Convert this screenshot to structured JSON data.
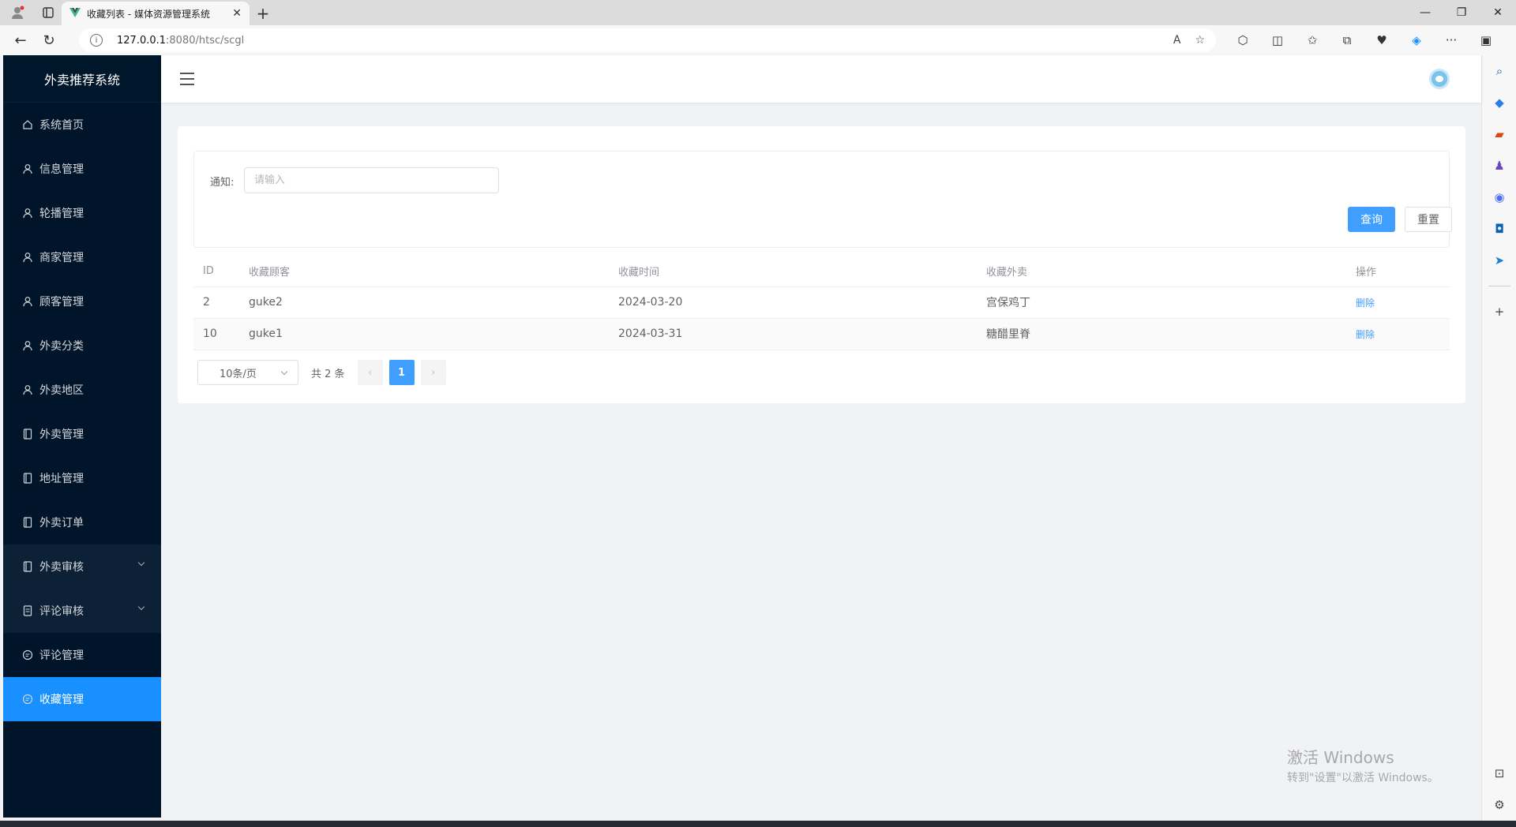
{
  "browser": {
    "tab_title": "收藏列表 - 媒体资源管理系统",
    "url_host": "127.0.0.1",
    "url_path": ":8080/htsc/scgl"
  },
  "app": {
    "logo": "外卖推荐系统"
  },
  "sidebar": {
    "items": [
      {
        "label": "系统首页",
        "icon": "home-icon"
      },
      {
        "label": "信息管理",
        "icon": "user-icon"
      },
      {
        "label": "轮播管理",
        "icon": "user-icon"
      },
      {
        "label": "商家管理",
        "icon": "user-icon"
      },
      {
        "label": "顾客管理",
        "icon": "user-icon"
      },
      {
        "label": "外卖分类",
        "icon": "user-icon"
      },
      {
        "label": "外卖地区",
        "icon": "user-icon"
      },
      {
        "label": "外卖管理",
        "icon": "tablet-icon"
      },
      {
        "label": "地址管理",
        "icon": "tablet-icon"
      },
      {
        "label": "外卖订单",
        "icon": "tablet-icon"
      },
      {
        "label": "外卖审核",
        "icon": "tablet-icon"
      },
      {
        "label": "评论审核",
        "icon": "document-icon"
      },
      {
        "label": "评论管理",
        "icon": "chat-icon"
      },
      {
        "label": "收藏管理",
        "icon": "chat-icon"
      }
    ]
  },
  "search": {
    "label": "通知:",
    "placeholder": "请输入",
    "query_button": "查询",
    "reset_button": "重置"
  },
  "table": {
    "headers": [
      "ID",
      "收藏顾客",
      "收藏时间",
      "收藏外卖",
      "操作"
    ],
    "rows": [
      {
        "id": "2",
        "customer": "guke2",
        "time": "2024-03-20",
        "food": "宫保鸡丁",
        "action": "删除"
      },
      {
        "id": "10",
        "customer": "guke1",
        "time": "2024-03-31",
        "food": "糖醋里脊",
        "action": "删除"
      }
    ]
  },
  "pagination": {
    "page_size": "10条/页",
    "total": "共 2 条",
    "current_page": "1"
  },
  "watermark": {
    "line1": "激活 Windows",
    "line2": "转到\"设置\"以激活 Windows。"
  },
  "colors": {
    "sidebar_bg": "#001529",
    "active": "#1890ff",
    "primary": "#409eff"
  }
}
